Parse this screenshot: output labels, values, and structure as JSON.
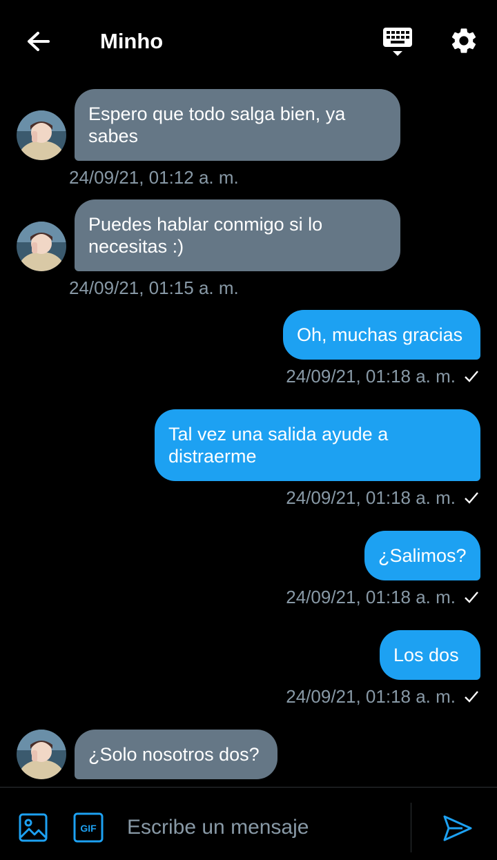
{
  "header": {
    "title": "Minho",
    "back_icon": "arrow-left-icon",
    "keyboard_icon": "keyboard-icon",
    "settings_icon": "gear-icon"
  },
  "messages": [
    {
      "direction": "in",
      "text": "Espero que todo salga bien, ya sabes",
      "timestamp": "24/09/21, 01:12 a. m."
    },
    {
      "direction": "in",
      "text": "Puedes hablar conmigo si lo necesitas :)",
      "timestamp": "24/09/21, 01:15 a. m."
    },
    {
      "direction": "out",
      "text": "Oh, muchas gracias",
      "timestamp": "24/09/21, 01:18 a. m.",
      "status": "sent"
    },
    {
      "direction": "out",
      "text": "Tal vez una salida ayude a distraerme",
      "timestamp": "24/09/21, 01:18 a. m.",
      "status": "sent"
    },
    {
      "direction": "out",
      "text": "¿Salimos?",
      "timestamp": "24/09/21, 01:18 a. m.",
      "status": "sent"
    },
    {
      "direction": "out",
      "text": "Los dos",
      "timestamp": "24/09/21, 01:18 a. m.",
      "status": "sent"
    },
    {
      "direction": "in",
      "text": "¿Solo nosotros dos?"
    }
  ],
  "composer": {
    "placeholder": "Escribe un mensaje",
    "gif_label": "GIF"
  },
  "colors": {
    "background": "#000000",
    "incoming_bubble": "#657786",
    "outgoing_bubble": "#1da1f2",
    "timestamp": "#8899a6",
    "accent": "#1da1f2"
  }
}
